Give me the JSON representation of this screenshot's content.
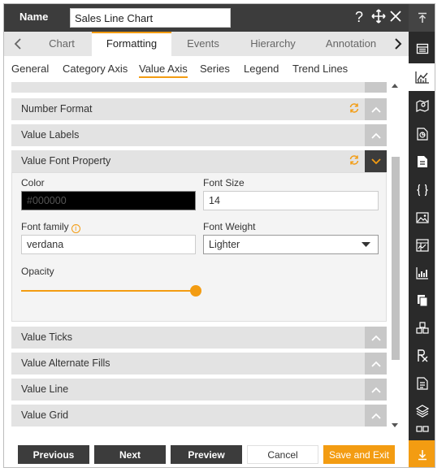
{
  "header": {
    "label": "Name",
    "name_value": "Sales Line Chart",
    "help_icon": "question-icon",
    "move_icon": "move-icon",
    "close_icon": "close-icon"
  },
  "tabs": [
    "Chart",
    "Formatting",
    "Events",
    "Hierarchy",
    "Annotation"
  ],
  "active_tab": "Formatting",
  "subtabs": [
    "General",
    "Category Axis",
    "Value Axis",
    "Series",
    "Legend",
    "Trend Lines"
  ],
  "active_subtab": "Value Axis",
  "sections": {
    "number_format": "Number Format",
    "value_labels": "Value Labels",
    "value_font_property": "Value Font Property",
    "value_ticks": "Value Ticks",
    "value_alternate_fills": "Value Alternate Fills",
    "value_line": "Value Line",
    "value_grid": "Value Grid"
  },
  "font_property": {
    "color_label": "Color",
    "color_value": "#000000",
    "font_size_label": "Font Size",
    "font_size_value": "14",
    "font_family_label": "Font family",
    "font_family_value": "verdana",
    "font_weight_label": "Font Weight",
    "font_weight_value": "Lighter",
    "opacity_label": "Opacity",
    "opacity_level": 1.0
  },
  "footer": {
    "previous": "Previous",
    "next": "Next",
    "preview": "Preview",
    "cancel": "Cancel",
    "save": "Save and Exit"
  },
  "colors": {
    "accent": "#f39c12",
    "header_bg": "#3c3c3c",
    "rail_bg": "#2a2a2a"
  }
}
